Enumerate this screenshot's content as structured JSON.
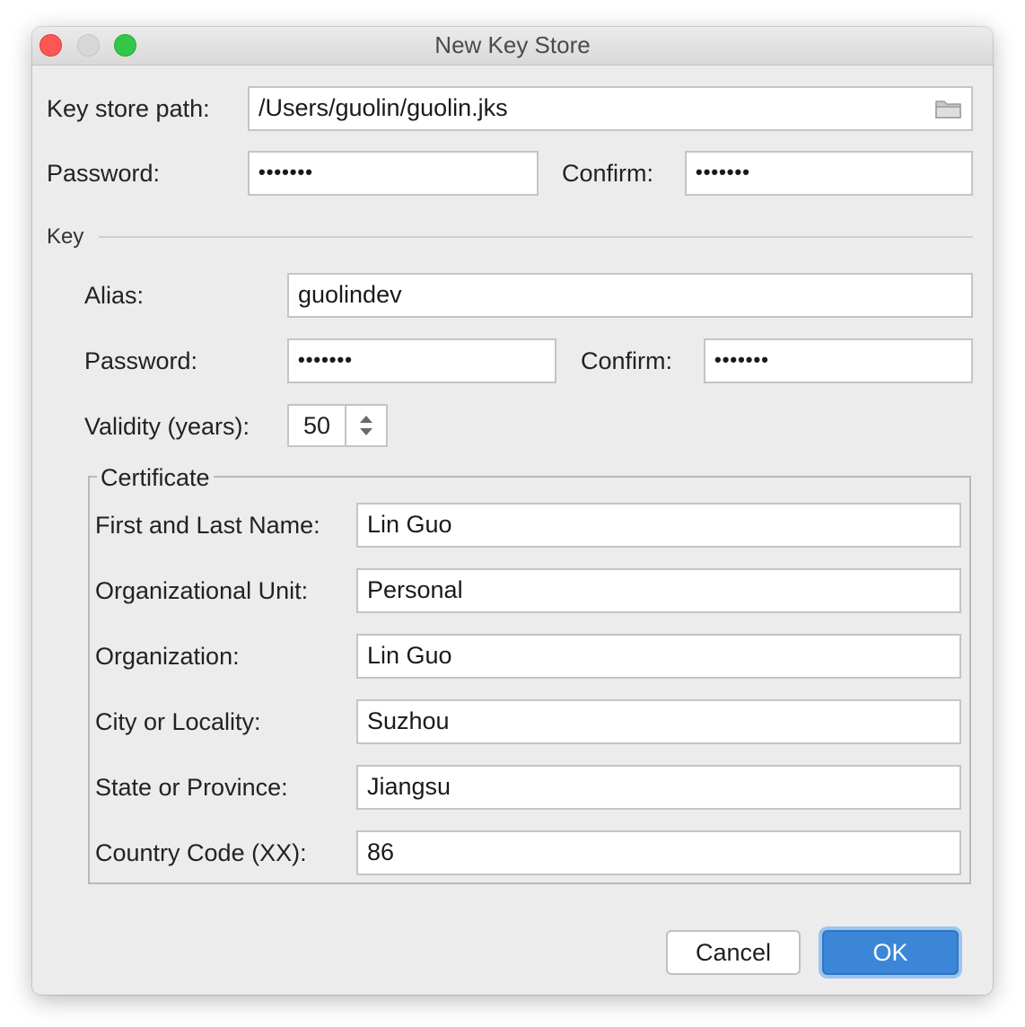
{
  "window": {
    "title": "New Key Store"
  },
  "keystore": {
    "path_label": "Key store path:",
    "path_value": "/Users/guolin/guolin.jks",
    "password_label": "Password:",
    "password_value": "•••••••",
    "confirm_label": "Confirm:",
    "confirm_value": "•••••••"
  },
  "key": {
    "section_label": "Key",
    "alias_label": "Alias:",
    "alias_value": "guolindev",
    "password_label": "Password:",
    "password_value": "•••••••",
    "confirm_label": "Confirm:",
    "confirm_value": "•••••••",
    "validity_label": "Validity (years):",
    "validity_value": "50"
  },
  "certificate": {
    "legend": "Certificate",
    "fields": [
      {
        "label": "First and Last Name:",
        "value": "Lin Guo"
      },
      {
        "label": "Organizational Unit:",
        "value": "Personal"
      },
      {
        "label": "Organization:",
        "value": "Lin Guo"
      },
      {
        "label": "City or Locality:",
        "value": "Suzhou"
      },
      {
        "label": "State or Province:",
        "value": "Jiangsu"
      },
      {
        "label": "Country Code (XX):",
        "value": "86"
      }
    ]
  },
  "buttons": {
    "cancel": "Cancel",
    "ok": "OK"
  },
  "icons": {
    "folder": "folder-icon",
    "spinner": "up-down-arrows-icon"
  },
  "colors": {
    "accent": "#3b86d6",
    "close": "#fc5753",
    "maximize": "#33c748",
    "minimize": "#d8d8d8"
  }
}
